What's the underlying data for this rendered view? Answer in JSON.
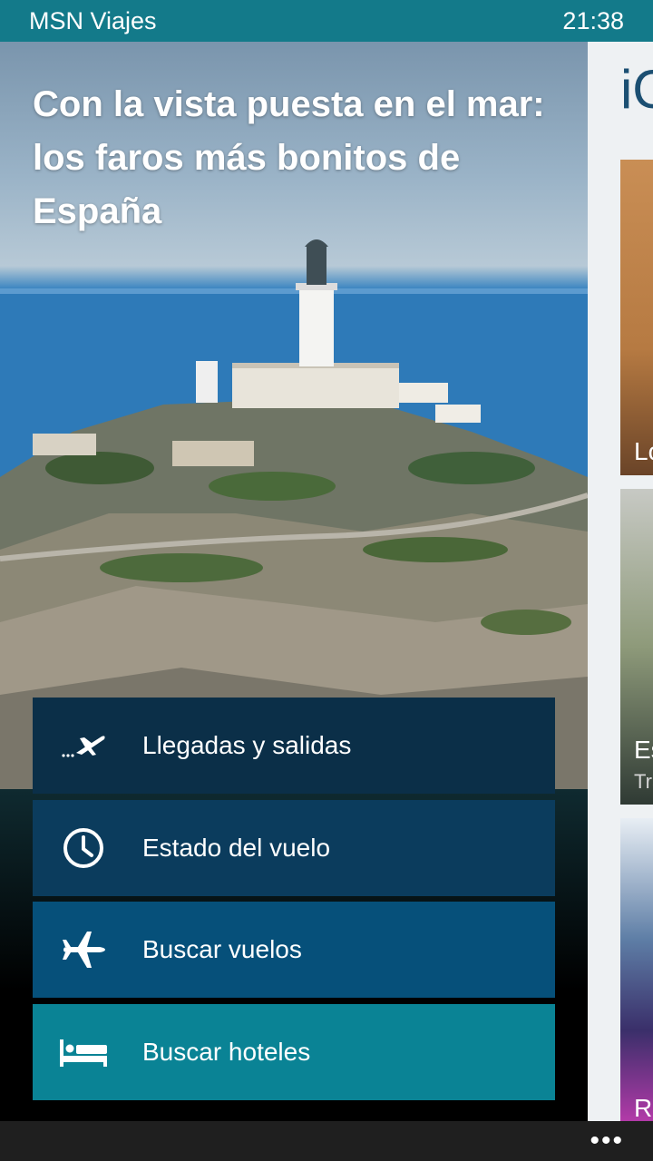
{
  "statusbar": {
    "app_name": "MSN Viajes",
    "time": "21:38"
  },
  "hero": {
    "title": "Con la vista puesta en el mar: los faros más bonitos de España"
  },
  "peek": {
    "header": "iO",
    "cards": [
      {
        "title": "Lo",
        "subtitle": ""
      },
      {
        "title": "Es",
        "subtitle": "Tra"
      },
      {
        "title": "Re",
        "subtitle": ""
      }
    ]
  },
  "actions": [
    {
      "label": "Llegadas y salidas",
      "icon": "plane-departing-icon"
    },
    {
      "label": "Estado del vuelo",
      "icon": "clock-icon"
    },
    {
      "label": "Buscar vuelos",
      "icon": "airplane-icon"
    },
    {
      "label": "Buscar hoteles",
      "icon": "bed-icon"
    }
  ],
  "appbar": {
    "more_label": "•••"
  },
  "colors": {
    "accent": "#137a8a",
    "button_1": "#0b2f48",
    "button_2": "#0b3c5d",
    "button_3": "#06507a",
    "button_4": "#0a8395"
  }
}
